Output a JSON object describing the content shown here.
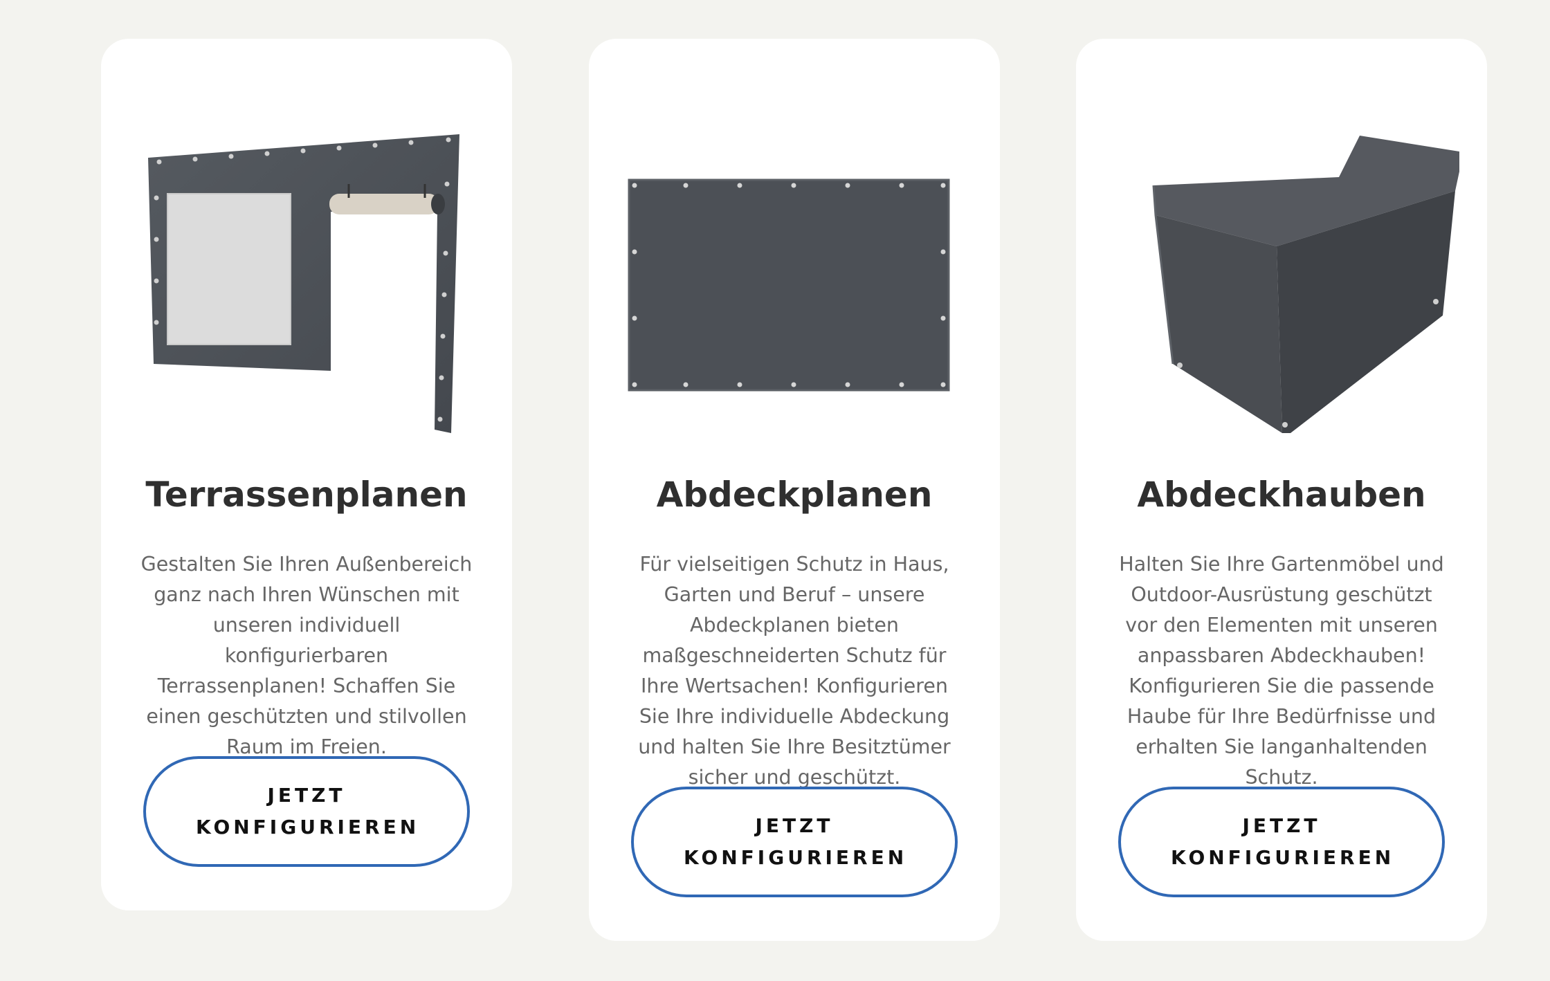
{
  "colors": {
    "page_background": "#f3f3ef",
    "card_background": "#ffffff",
    "button_border": "#3068b5",
    "title_text": "#2f2f2f",
    "body_text": "#666666",
    "tarp_gray": "#4b4f55"
  },
  "cards": [
    {
      "image": "terrace-curtain-with-window-image",
      "title": "Terrassenplanen",
      "description": "Gestalten Sie Ihren Außenbereich ganz nach Ihren Wünschen mit unseren individuell konfigurierbaren Terrassenplanen! Schaffen Sie einen geschützten und stilvollen Raum im Freien.",
      "button_label": "JETZT KONFIGURIEREN"
    },
    {
      "image": "flat-cover-tarp-image",
      "title": "Abdeckplanen",
      "description": "Für vielseitigen Schutz in Haus, Garten und Beruf – unsere Abdeckplanen bieten maßgeschneiderten Schutz für Ihre Wertsachen! Konfigurieren Sie Ihre individuelle Abdeckung und halten Sie Ihre Besitztümer sicher und geschützt.",
      "button_label": "JETZT KONFIGURIEREN"
    },
    {
      "image": "furniture-cover-hood-image",
      "title": "Abdeckhauben",
      "description": "Halten Sie Ihre Gartenmöbel und Outdoor-Ausrüstung geschützt vor den Elementen mit unseren anpassbaren Abdeckhauben! Konfigurieren Sie die passende Haube für Ihre Bedürfnisse und erhalten Sie langanhaltenden Schutz.",
      "button_label": "JETZT KONFIGURIEREN"
    }
  ]
}
